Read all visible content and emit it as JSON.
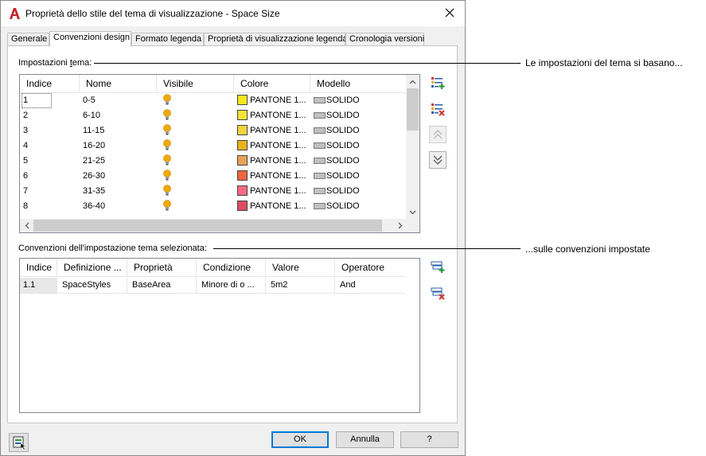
{
  "window": {
    "title": "Proprietà dello stile del tema di visualizzazione - Space Size",
    "close_glyph": "✕"
  },
  "tabs": [
    {
      "label": "Generale"
    },
    {
      "label": "Convenzioni design"
    },
    {
      "label": "Formato legenda"
    },
    {
      "label": "Proprietà di visualizzazione legenda"
    },
    {
      "label": "Cronologia versioni"
    }
  ],
  "theme_settings": {
    "label_before": "Impostazioni ",
    "label_underlined": "t",
    "label_after": "ema:",
    "columns": [
      "Indice",
      "Nome",
      "Visibile",
      "Colore",
      "Modello"
    ],
    "rows": [
      {
        "index": "1",
        "name": "0-5",
        "color_name": "PANTONE 1...",
        "color": "#f7e81d",
        "pattern": "SOLIDO"
      },
      {
        "index": "2",
        "name": "6-10",
        "color_name": "PANTONE 1...",
        "color": "#f7e23a",
        "pattern": "SOLIDO"
      },
      {
        "index": "3",
        "name": "11-15",
        "color_name": "PANTONE 1...",
        "color": "#f2d43a",
        "pattern": "SOLIDO"
      },
      {
        "index": "4",
        "name": "16-20",
        "color_name": "PANTONE 1...",
        "color": "#e9b21c",
        "pattern": "SOLIDO"
      },
      {
        "index": "5",
        "name": "21-25",
        "color_name": "PANTONE 1...",
        "color": "#e8a257",
        "pattern": "SOLIDO"
      },
      {
        "index": "6",
        "name": "26-30",
        "color_name": "PANTONE 1...",
        "color": "#f26440",
        "pattern": "SOLIDO"
      },
      {
        "index": "7",
        "name": "31-35",
        "color_name": "PANTONE 1...",
        "color": "#f56b7f",
        "pattern": "SOLIDO"
      },
      {
        "index": "8",
        "name": "36-40",
        "color_name": "PANTONE 1...",
        "color": "#dc4c63",
        "pattern": "SOLIDO"
      }
    ]
  },
  "rules": {
    "label": "Convenzioni dell'impostazione tema selezionata:",
    "columns": [
      "Indice",
      "Definizione ...",
      "Proprietà",
      "Condizione",
      "Valore",
      "Operatore"
    ],
    "rows": [
      {
        "index": "1.1",
        "definition": "SpaceStyles",
        "property": "BaseArea",
        "condition": "Minore di o ...",
        "value": "5m2",
        "operator": "And"
      }
    ]
  },
  "buttons": {
    "ok": "OK",
    "cancel": "Annulla",
    "help": "?"
  },
  "callouts": {
    "top": "Le impostazioni del tema si basano...",
    "bottom": "...sulle convenzioni impostate"
  },
  "colors": {
    "accent": "#0078d7",
    "app_icon": "#c1272d",
    "bulb": "#f2a900",
    "add_green": "#2e9e3c",
    "remove_red": "#d0312d",
    "icon_blue": "#2a5ea8"
  }
}
